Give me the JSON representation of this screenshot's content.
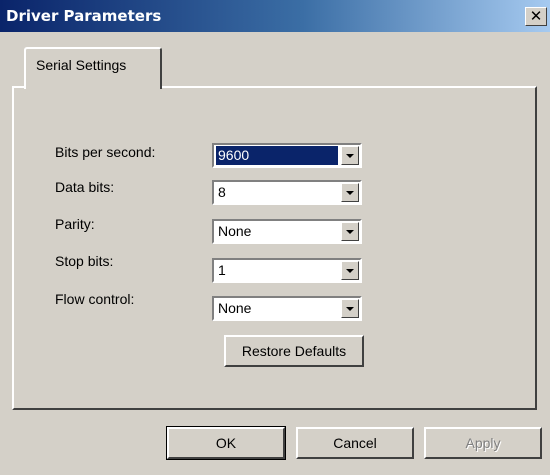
{
  "window": {
    "title": "Driver Parameters",
    "close_glyph": "✕"
  },
  "tabs": [
    {
      "label": "Serial Settings",
      "active": true
    }
  ],
  "fields": {
    "bits_per_second": {
      "label": "Bits per second:",
      "value": "9600",
      "selected": true
    },
    "data_bits": {
      "label": "Data bits:",
      "value": "8"
    },
    "parity": {
      "label": "Parity:",
      "value": "None"
    },
    "stop_bits": {
      "label": "Stop bits:",
      "value": "1"
    },
    "flow_control": {
      "label": "Flow control:",
      "value": "None"
    }
  },
  "buttons": {
    "restore_defaults": "Restore Defaults",
    "ok": "OK",
    "cancel": "Cancel",
    "apply": "Apply",
    "apply_enabled": false
  },
  "icons": {
    "close": "close-icon",
    "dropdown": "chevron-down-icon"
  },
  "colors": {
    "titlebar_start": "#0a246a",
    "titlebar_end": "#a6caf0",
    "face": "#d4d0c8",
    "selection": "#0a246a",
    "disabled_text": "#808080"
  }
}
